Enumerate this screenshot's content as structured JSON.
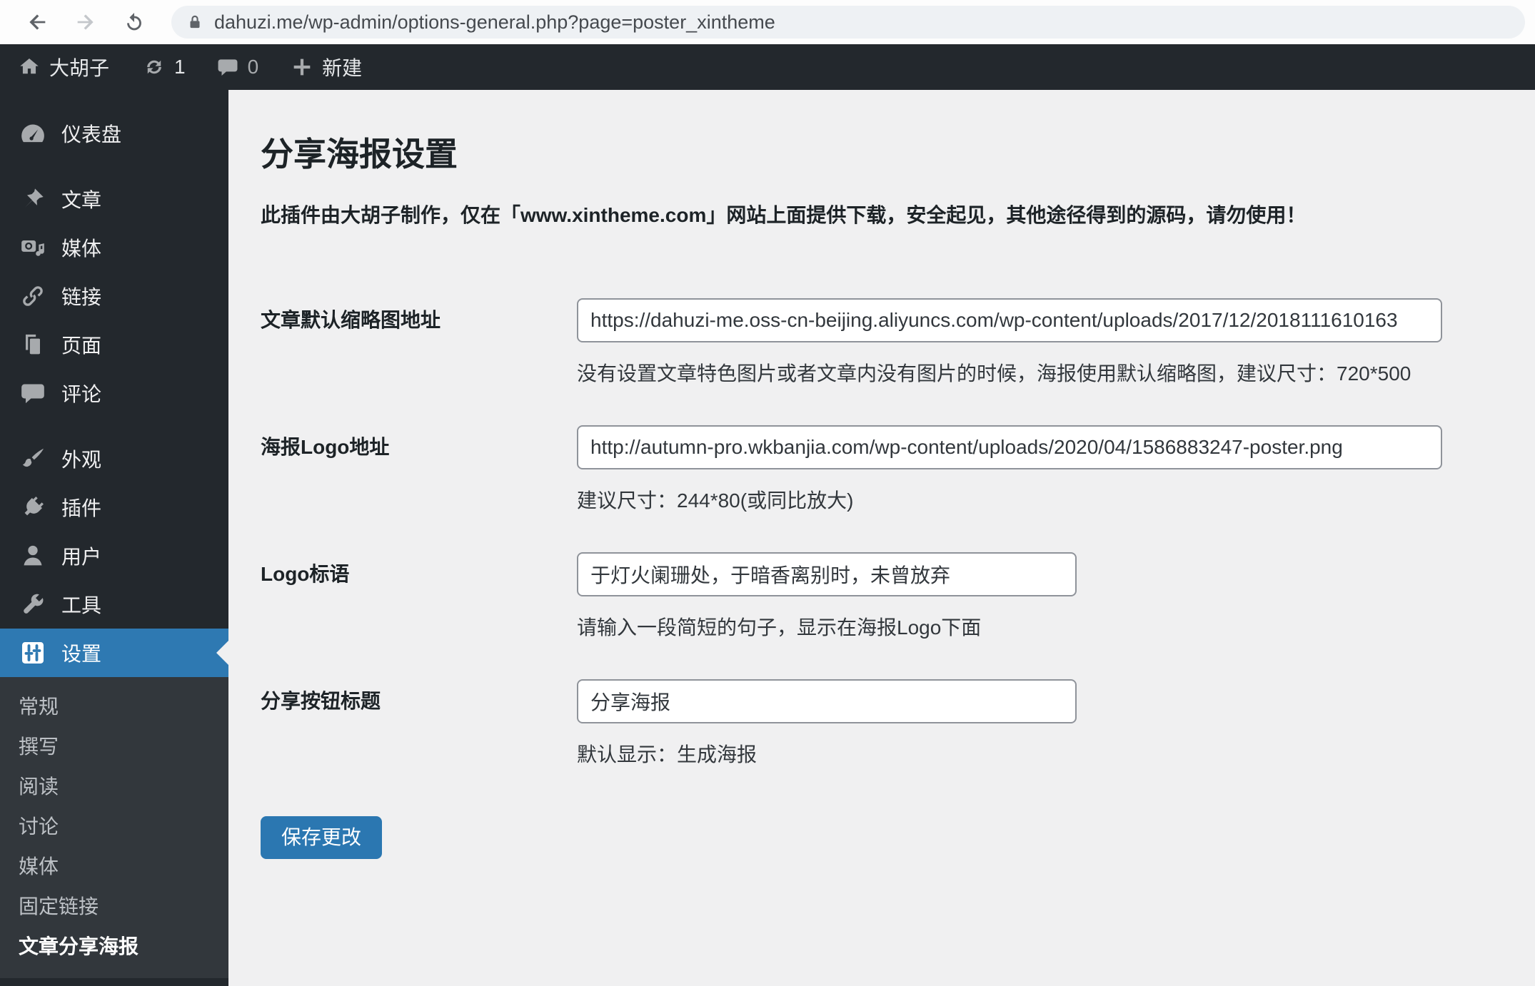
{
  "browser": {
    "url": "dahuzi.me/wp-admin/options-general.php?page=poster_xintheme"
  },
  "admin_bar": {
    "site_name": "大胡子",
    "update_count": "1",
    "comment_count": "0",
    "new_label": "新建"
  },
  "sidebar": {
    "items": [
      {
        "label": "仪表盘",
        "icon": "dashboard-icon"
      },
      {
        "label": "文章",
        "icon": "posts-pin-icon"
      },
      {
        "label": "媒体",
        "icon": "media-camera-icon"
      },
      {
        "label": "链接",
        "icon": "links-chain-icon"
      },
      {
        "label": "页面",
        "icon": "pages-icon"
      },
      {
        "label": "评论",
        "icon": "comments-bubble-icon"
      },
      {
        "label": "外观",
        "icon": "appearance-brush-icon"
      },
      {
        "label": "插件",
        "icon": "plugins-plug-icon"
      },
      {
        "label": "用户",
        "icon": "users-person-icon"
      },
      {
        "label": "工具",
        "icon": "tools-wrench-icon"
      },
      {
        "label": "设置",
        "icon": "settings-sliders-icon",
        "active": true
      }
    ],
    "submenu": [
      "常规",
      "撰写",
      "阅读",
      "讨论",
      "媒体",
      "固定链接",
      "文章分享海报"
    ]
  },
  "main": {
    "title": "分享海报设置",
    "notice": "此插件由大胡子制作，仅在「www.xintheme.com」网站上面提供下载，安全起见，其他途径得到的源码，请勿使用！",
    "fields": [
      {
        "label": "文章默认缩略图地址",
        "value": "https://dahuzi-me.oss-cn-beijing.aliyuncs.com/wp-content/uploads/2017/12/2018111610163",
        "help": "没有设置文章特色图片或者文章内没有图片的时候，海报使用默认缩略图，建议尺寸：720*500"
      },
      {
        "label": "海报Logo地址",
        "value": "http://autumn-pro.wkbanjia.com/wp-content/uploads/2020/04/1586883247-poster.png",
        "help": "建议尺寸：244*80(或同比放大)"
      },
      {
        "label": "Logo标语",
        "value": "于灯火阑珊处，于暗香离别时，未曾放弃",
        "help": "请输入一段简短的句子，显示在海报Logo下面"
      },
      {
        "label": "分享按钮标题",
        "value": "分享海报",
        "help": "默认显示：生成海报"
      }
    ],
    "save_label": "保存更改"
  },
  "colors": {
    "accent_blue": "#2e79b2",
    "button_blue": "#2b77b1",
    "sidebar_bg": "#23282d",
    "submenu_bg": "#32373c",
    "content_bg": "#f0f0f1"
  }
}
